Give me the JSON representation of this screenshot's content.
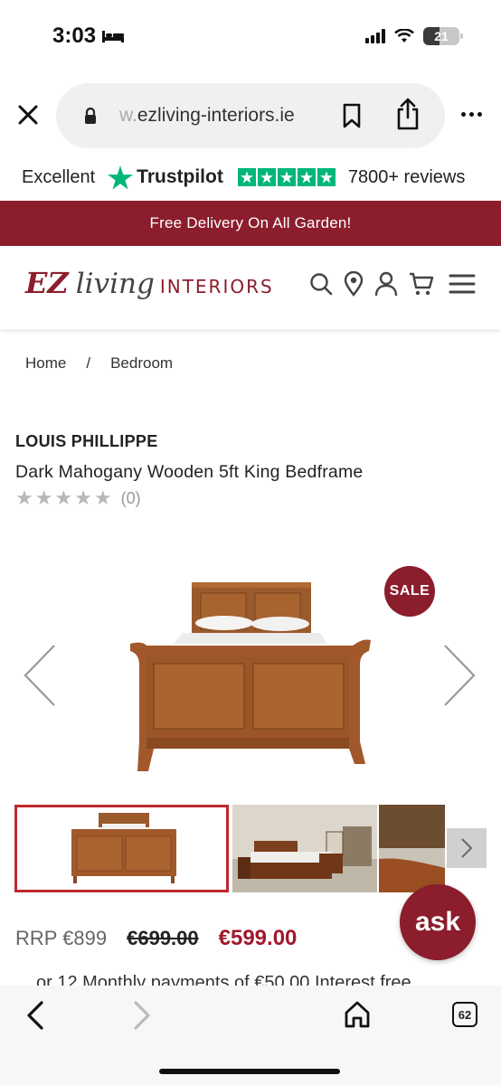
{
  "status": {
    "time": "3:03",
    "battery": "21"
  },
  "browser": {
    "url_prefix": "w.",
    "url_domain": "ezliving-interiors.ie"
  },
  "trustpilot": {
    "rating_word": "Excellent",
    "brand": "Trustpilot",
    "reviews": "7800+ reviews"
  },
  "banner": {
    "text": "Free Delivery On All Garden!"
  },
  "logo": {
    "ez": "EZ",
    "living": "living",
    "interiors": "INTERIORS"
  },
  "breadcrumb": {
    "home": "Home",
    "separator": "/",
    "current": "Bedroom"
  },
  "product": {
    "brand": "LOUIS PHILLIPPE",
    "title": "Dark Mahogany Wooden 5ft King Bedframe",
    "rating_count": "(0)",
    "stars": 0,
    "sale_badge": "SALE",
    "rrp": "RRP €899",
    "was_price": "€699.00",
    "now_price": "€599.00",
    "finance_text": "or 12 Monthly payments of €50.00 Interest free"
  },
  "ask": {
    "label": "ask"
  },
  "toolbar": {
    "tab_count": "62"
  },
  "colors": {
    "brand": "#8b1d2c",
    "trustpilot": "#00b67a",
    "sale_price": "#a0192c"
  }
}
